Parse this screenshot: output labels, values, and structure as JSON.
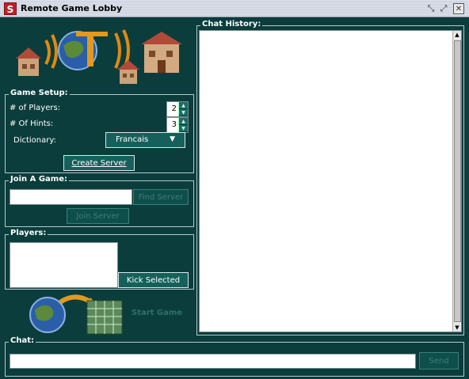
{
  "window": {
    "title": "Remote Game Lobby",
    "app_icon_letter": "S"
  },
  "icons": {
    "logo": "network-houses-logo",
    "start_game": "globe-to-board-icon"
  },
  "game_setup": {
    "label": "Game Setup:",
    "players_label": "# of Players:",
    "players_value": "2",
    "hints_label": "# Of Hints:",
    "hints_value": "3",
    "dictionary_label": "Dictionary:",
    "dictionary_value": "Francais",
    "create_server": "Create Server"
  },
  "join_game": {
    "label": "Join A Game:",
    "server_input_value": "",
    "find_button": "Find Server",
    "join_button": "Join Server"
  },
  "players": {
    "label": "Players:",
    "items": [],
    "kick_button": "Kick Selected"
  },
  "start_game": {
    "label": "Start Game"
  },
  "chat_history": {
    "label": "Chat History:"
  },
  "chat": {
    "label": "Chat:",
    "input_value": "",
    "send_button": "Send"
  },
  "colors": {
    "background": "#0b3d3d",
    "button": "#16605b",
    "border": "#d8e8e8"
  }
}
